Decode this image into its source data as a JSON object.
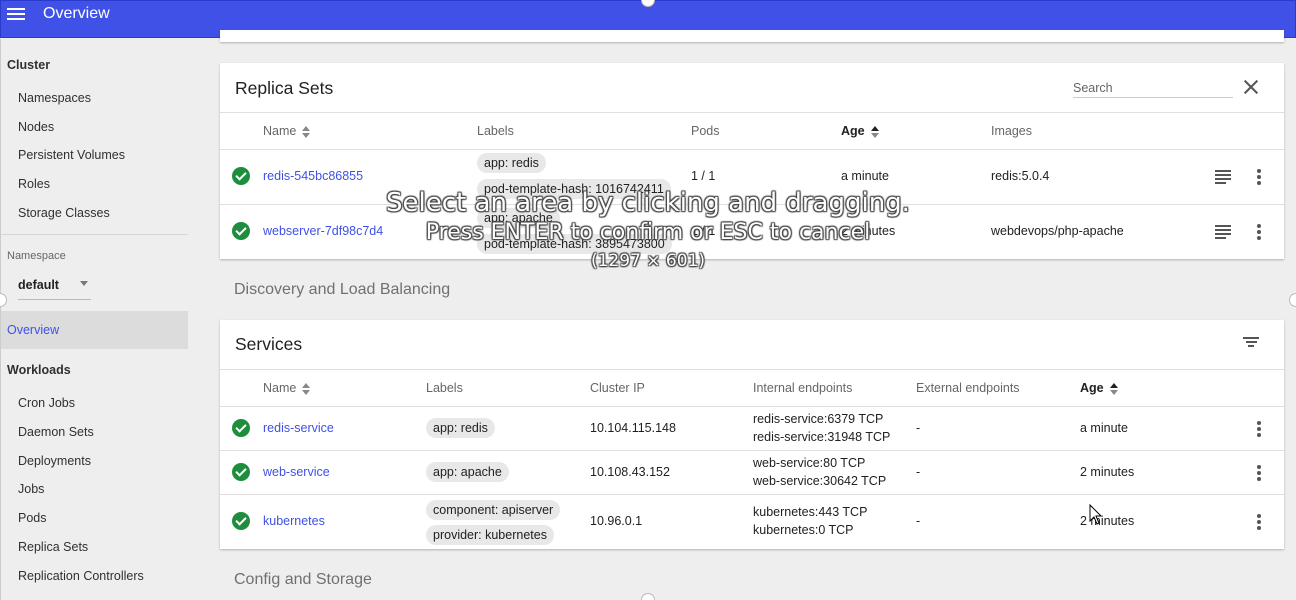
{
  "header": {
    "title": "Overview"
  },
  "sidebar": {
    "cluster_heading": "Cluster",
    "cluster_items": [
      "Namespaces",
      "Nodes",
      "Persistent Volumes",
      "Roles",
      "Storage Classes"
    ],
    "namespace_label": "Namespace",
    "namespace_value": "default",
    "active_item": "Overview",
    "workloads_heading": "Workloads",
    "workload_items": [
      "Cron Jobs",
      "Daemon Sets",
      "Deployments",
      "Jobs",
      "Pods",
      "Replica Sets",
      "Replication Controllers"
    ]
  },
  "replica_sets": {
    "title": "Replica Sets",
    "search_placeholder": "Search",
    "columns": {
      "name": "Name",
      "labels": "Labels",
      "pods": "Pods",
      "age": "Age",
      "images": "Images"
    },
    "rows": [
      {
        "name": "redis-545bc86855",
        "labels": [
          "app: redis",
          "pod-template-hash: 1016742411"
        ],
        "pods": "1 / 1",
        "age": "a minute",
        "image": "redis:5.0.4"
      },
      {
        "name": "webserver-7df98c7d4",
        "labels": [
          "app: apache",
          "pod-template-hash: 3895473800"
        ],
        "pods": "1 / 1",
        "age": "2 minutes",
        "image": "webdevops/php-apache"
      }
    ]
  },
  "discovery_section": "Discovery and Load Balancing",
  "services": {
    "title": "Services",
    "columns": {
      "name": "Name",
      "labels": "Labels",
      "cluster_ip": "Cluster IP",
      "internal": "Internal endpoints",
      "external": "External endpoints",
      "age": "Age"
    },
    "rows": [
      {
        "name": "redis-service",
        "labels": [
          "app: redis"
        ],
        "cluster_ip": "10.104.115.148",
        "internal": [
          "redis-service:6379 TCP",
          "redis-service:31948 TCP"
        ],
        "external": "-",
        "age": "a minute"
      },
      {
        "name": "web-service",
        "labels": [
          "app: apache"
        ],
        "cluster_ip": "10.108.43.152",
        "internal": [
          "web-service:80 TCP",
          "web-service:30642 TCP"
        ],
        "external": "-",
        "age": "2 minutes"
      },
      {
        "name": "kubernetes",
        "labels": [
          "component: apiserver",
          "provider: kubernetes"
        ],
        "cluster_ip": "10.96.0.1",
        "internal": [
          "kubernetes:443 TCP",
          "kubernetes:0 TCP"
        ],
        "external": "-",
        "age": "2 minutes"
      }
    ]
  },
  "config_section": "Config and Storage",
  "screenshot_overlay": {
    "line1": "Select an area by clicking and dragging.",
    "line2": "Press ENTER to confirm or ESC to cancel",
    "line3": "(1297 × 601)"
  },
  "colors": {
    "primary": "#3f51e7",
    "status_ok": "#1e8e3e"
  }
}
